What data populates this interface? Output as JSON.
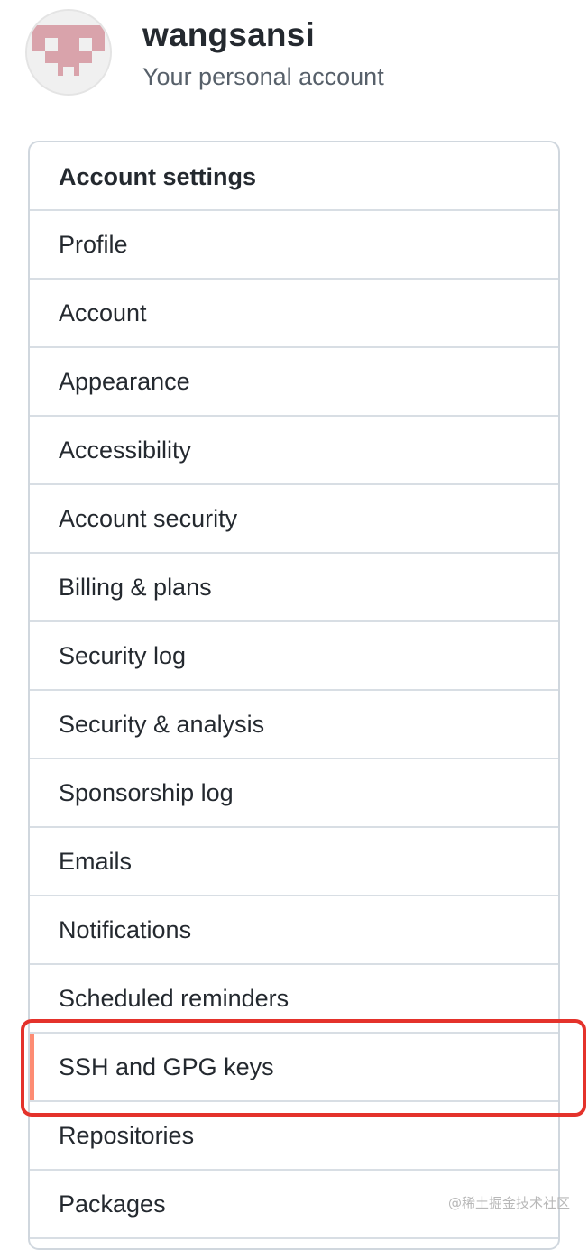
{
  "header": {
    "username": "wangsansi",
    "subtitle": "Your personal account"
  },
  "menu": {
    "heading": "Account settings",
    "items": [
      {
        "label": "Profile"
      },
      {
        "label": "Account"
      },
      {
        "label": "Appearance"
      },
      {
        "label": "Accessibility"
      },
      {
        "label": "Account security"
      },
      {
        "label": "Billing & plans"
      },
      {
        "label": "Security log"
      },
      {
        "label": "Security & analysis"
      },
      {
        "label": "Sponsorship log"
      },
      {
        "label": "Emails"
      },
      {
        "label": "Notifications"
      },
      {
        "label": "Scheduled reminders"
      },
      {
        "label": "SSH and GPG keys",
        "selected": true
      },
      {
        "label": "Repositories"
      },
      {
        "label": "Packages"
      }
    ]
  },
  "colors": {
    "selected_indicator": "#fd8c73",
    "annotation_box": "#e4322b",
    "avatar_pattern": "#d9a3ab"
  },
  "watermark": "@稀土掘金技术社区"
}
